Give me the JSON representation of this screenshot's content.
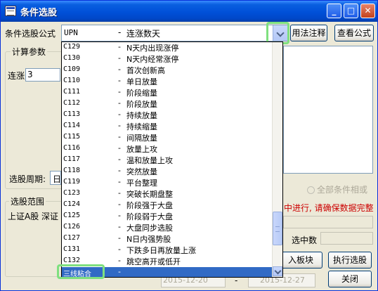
{
  "window": {
    "title": "条件选股"
  },
  "formula": {
    "label": "条件选股公式",
    "selected_code": "UPN",
    "selected_name": "连涨数天",
    "usage_button": "用法注释",
    "view_button": "查看公式"
  },
  "params": {
    "group_title": "计算参数",
    "param_label": "连涨",
    "param_value": "3"
  },
  "period": {
    "label": "选股周期:",
    "value": "日"
  },
  "scope": {
    "group_title": "选股范围",
    "markets": "上证A股  深证"
  },
  "all_conditions": {
    "label": "全部条件相或"
  },
  "warning": "中进行, 请确保数据完整",
  "selected_count": {
    "label": "选中数"
  },
  "buttons": {
    "import": "入板块",
    "run": "执行选股",
    "close": "关闭"
  },
  "dates": {
    "start": "2015-12-20",
    "end": "2015-12-27",
    "separator": "-"
  },
  "dropdown": {
    "items": [
      {
        "code": "C129",
        "name": "N天内出现涨停"
      },
      {
        "code": "C130",
        "name": "N天内经常涨停"
      },
      {
        "code": "C109",
        "name": "首次创新高"
      },
      {
        "code": "C110",
        "name": "单日放量"
      },
      {
        "code": "C111",
        "name": "阶段缩量"
      },
      {
        "code": "C112",
        "name": "阶段放量"
      },
      {
        "code": "C113",
        "name": "持续放量"
      },
      {
        "code": "C114",
        "name": "持续缩量"
      },
      {
        "code": "C115",
        "name": "间隔放量"
      },
      {
        "code": "C116",
        "name": "放量上攻"
      },
      {
        "code": "C117",
        "name": "温和放量上攻"
      },
      {
        "code": "C118",
        "name": "突然放量"
      },
      {
        "code": "C119",
        "name": "平台整理"
      },
      {
        "code": "C123",
        "name": "突破长期盘整"
      },
      {
        "code": "C124",
        "name": "阶段强于大盘"
      },
      {
        "code": "C125",
        "name": "阶段弱于大盘"
      },
      {
        "code": "C126",
        "name": "大盘同步选股"
      },
      {
        "code": "C127",
        "name": "N日内强势股"
      },
      {
        "code": "C131",
        "name": "下跌多日再放量上涨"
      },
      {
        "code": "C132",
        "name": "跳空高开或低开"
      },
      {
        "code": "三线粘合",
        "name": ""
      }
    ],
    "separator": "-"
  },
  "colors": {
    "selection": "#316AC5",
    "highlight": "#7fe07f",
    "title_bar": "#0050D8"
  }
}
